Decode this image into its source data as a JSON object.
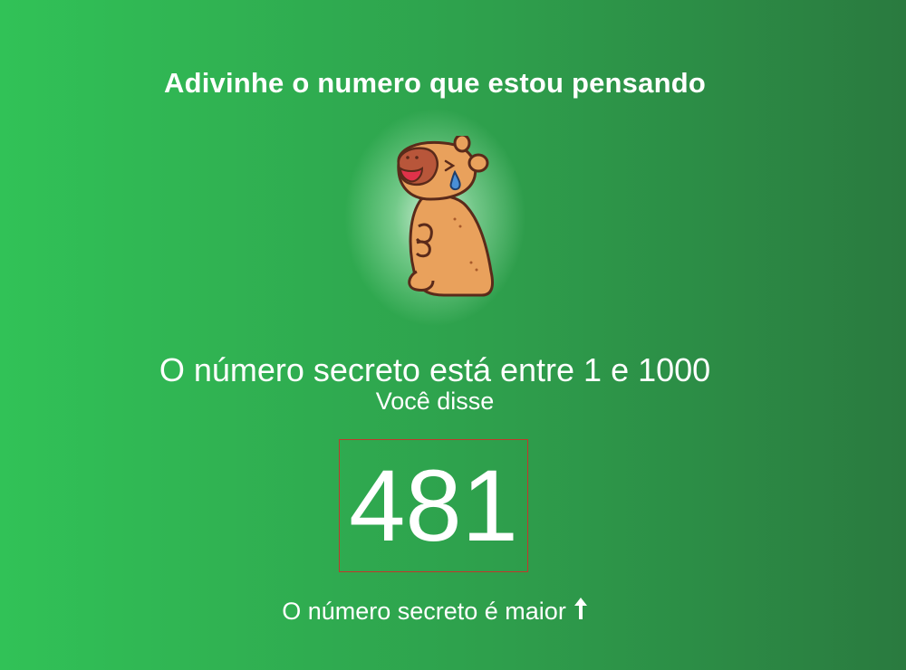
{
  "header": {
    "title": "Adivinhe o numero que estou pensando"
  },
  "mascot": {
    "icon": "capybara-crying-icon"
  },
  "game": {
    "range_text": "O número secreto está entre 1 e 1000",
    "said_label": "Você disse",
    "guess_value": "481",
    "hint_text": "O número secreto é maior",
    "hint_icon": "arrow-up-icon"
  },
  "colors": {
    "background_start": "#31c257",
    "background_end": "#2a7a3f",
    "guess_border": "#c0392b",
    "text": "#ffffff"
  }
}
